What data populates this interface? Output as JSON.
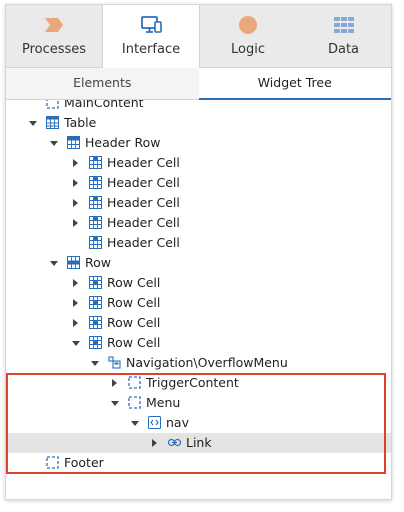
{
  "top_tabs": [
    {
      "label": "Processes",
      "icon": "processes-icon",
      "active": false
    },
    {
      "label": "Interface",
      "icon": "interface-icon",
      "active": true
    },
    {
      "label": "Logic",
      "icon": "logic-icon",
      "active": false
    },
    {
      "label": "Data",
      "icon": "data-icon",
      "active": false
    }
  ],
  "sub_tabs": [
    {
      "label": "Elements",
      "active": false
    },
    {
      "label": "Widget Tree",
      "active": true
    }
  ],
  "tree": [
    {
      "label": "MainContent",
      "icon": "container-icon",
      "expander": "none"
    },
    {
      "label": "Table",
      "icon": "table-icon",
      "expander": "expanded"
    },
    {
      "label": "Header Row",
      "icon": "header-row-icon",
      "expander": "expanded"
    },
    {
      "label": "Header Cell",
      "icon": "header-cell-icon",
      "expander": "collapsed"
    },
    {
      "label": "Header Cell",
      "icon": "header-cell-icon",
      "expander": "collapsed"
    },
    {
      "label": "Header Cell",
      "icon": "header-cell-icon",
      "expander": "collapsed"
    },
    {
      "label": "Header Cell",
      "icon": "header-cell-icon",
      "expander": "collapsed"
    },
    {
      "label": "Header Cell",
      "icon": "header-cell-icon",
      "expander": "none"
    },
    {
      "label": "Row",
      "icon": "row-icon",
      "expander": "expanded"
    },
    {
      "label": "Row Cell",
      "icon": "row-cell-icon",
      "expander": "collapsed"
    },
    {
      "label": "Row Cell",
      "icon": "row-cell-icon",
      "expander": "collapsed"
    },
    {
      "label": "Row Cell",
      "icon": "row-cell-icon",
      "expander": "collapsed"
    },
    {
      "label": "Row Cell",
      "icon": "row-cell-icon",
      "expander": "expanded"
    },
    {
      "label": "Navigation\\OverflowMenu",
      "icon": "block-icon",
      "expander": "expanded"
    },
    {
      "label": "TriggerContent",
      "icon": "container-icon",
      "expander": "collapsed"
    },
    {
      "label": "Menu",
      "icon": "container-icon",
      "expander": "expanded"
    },
    {
      "label": "nav",
      "icon": "html-element-icon",
      "expander": "expanded"
    },
    {
      "label": "Link",
      "icon": "link-icon",
      "expander": "collapsed",
      "selected": true
    },
    {
      "label": "Footer",
      "icon": "container-icon",
      "expander": "none"
    }
  ],
  "colors": {
    "accent": "#2a6ebb",
    "highlight_border": "#d9442b",
    "selected_row": "#e4e4e4"
  }
}
